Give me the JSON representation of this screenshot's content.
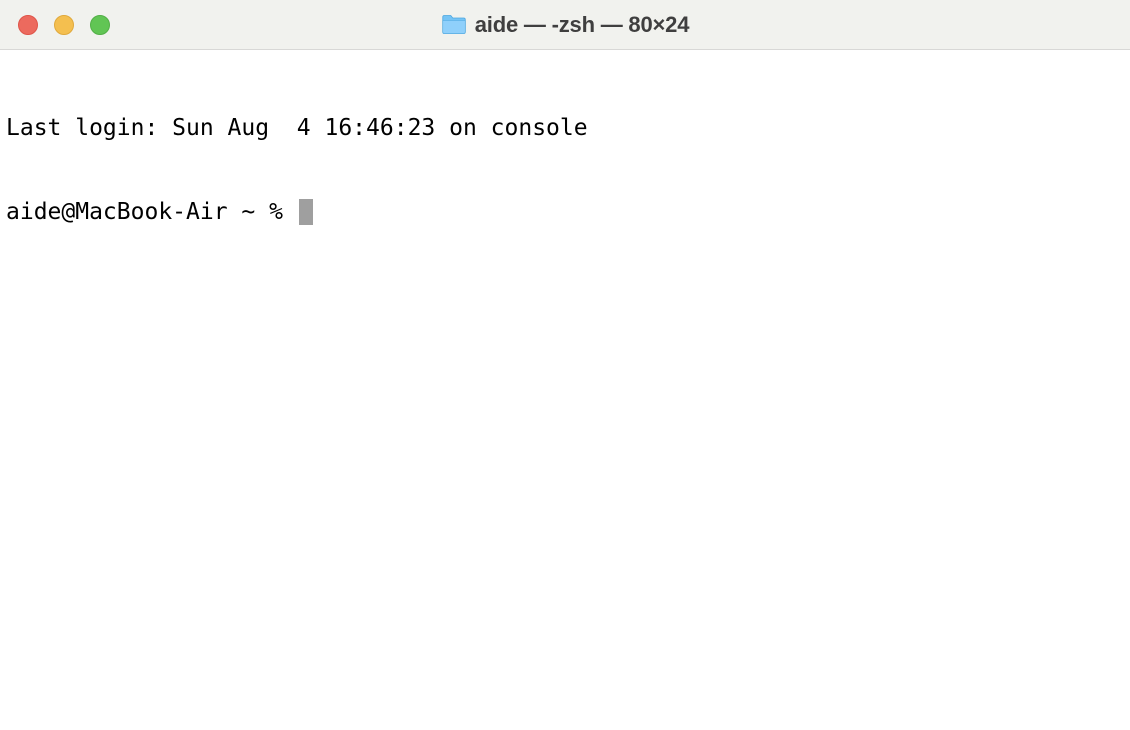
{
  "window": {
    "title": "aide — -zsh — 80×24"
  },
  "terminal": {
    "last_login": "Last login: Sun Aug  4 16:46:23 on console",
    "prompt": "aide@MacBook-Air ~ % "
  }
}
